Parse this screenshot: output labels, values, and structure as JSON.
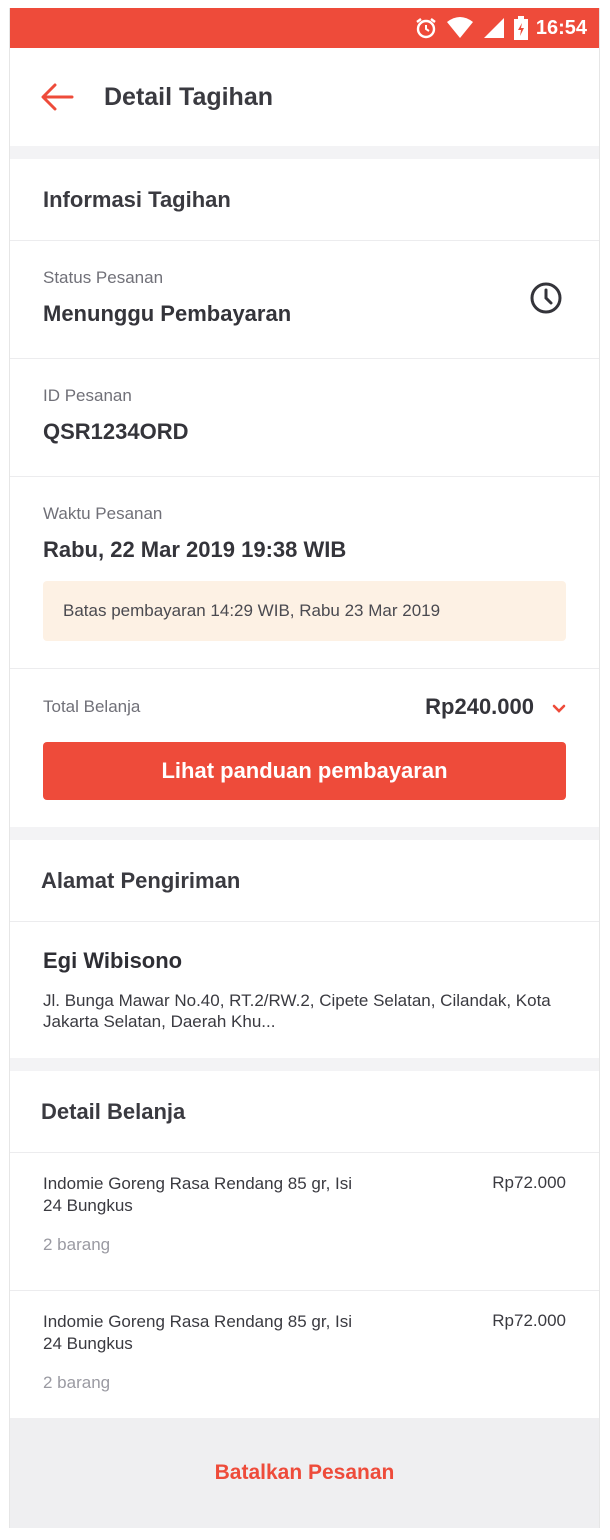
{
  "status_bar": {
    "time": "16:54"
  },
  "header": {
    "title": "Detail Tagihan"
  },
  "invoice": {
    "section_title": "Informasi Tagihan",
    "status_label": "Status Pesanan",
    "status_value": "Menunggu Pembayaran",
    "id_label": "ID Pesanan",
    "id_value": "QSR1234ORD",
    "time_label": "Waktu Pesanan",
    "time_value": "Rabu, 22 Mar 2019 19:38 WIB",
    "deadline_note": "Batas pembayaran 14:29 WIB, Rabu 23 Mar 2019",
    "total_label": "Total Belanja",
    "total_value": "Rp240.000",
    "guide_button": "Lihat panduan pembayaran"
  },
  "address": {
    "section_title": "Alamat Pengiriman",
    "name": "Egi Wibisono",
    "text": "Jl. Bunga Mawar No.40, RT.2/RW.2, Cipete Selatan, Cilandak, Kota Jakarta Selatan, Daerah Khu..."
  },
  "items": {
    "section_title": "Detail Belanja",
    "list": [
      {
        "name": "Indomie Goreng Rasa Rendang 85 gr, Isi 24 Bungkus",
        "price": "Rp72.000",
        "qty": "2 barang"
      },
      {
        "name": "Indomie Goreng Rasa Rendang 85 gr, Isi 24 Bungkus",
        "price": "Rp72.000",
        "qty": "2 barang"
      }
    ]
  },
  "footer": {
    "cancel_label": "Batalkan Pesanan"
  },
  "colors": {
    "accent": "#ee4b3a",
    "deadline_bg": "#fdf1e4",
    "divider": "#f3f3f5"
  },
  "icons": [
    "alarm-icon",
    "wifi-icon",
    "signal-icon",
    "battery-icon",
    "back-arrow-icon",
    "clock-icon",
    "chevron-down-icon"
  ]
}
